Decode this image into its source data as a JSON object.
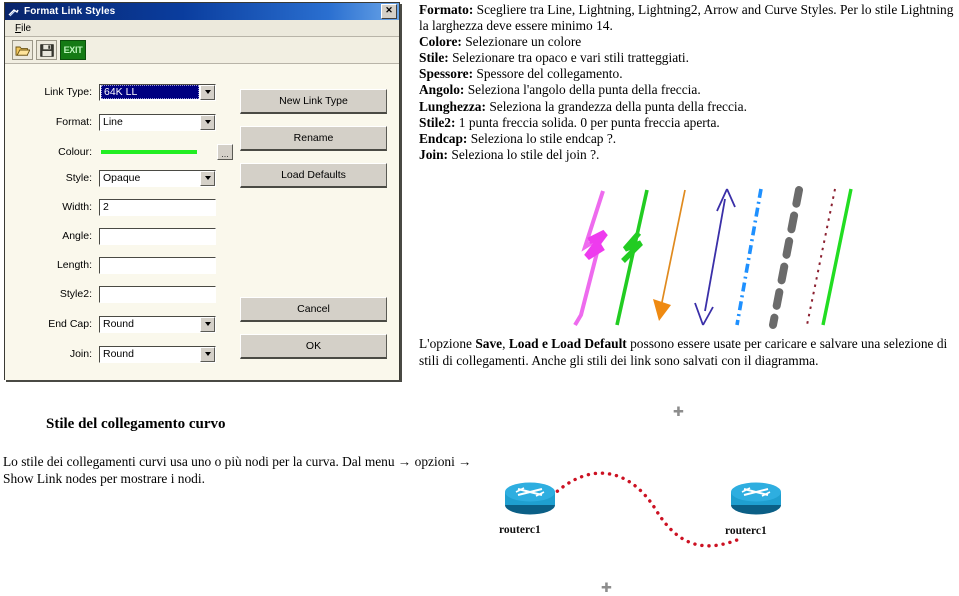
{
  "dialog": {
    "title": "Format Link Styles",
    "title_icon": "link-window-icon",
    "close_label": "✕",
    "menu": [
      {
        "label": "File",
        "accel": "F"
      }
    ],
    "toolbar": [
      {
        "name": "open-icon",
        "label": ""
      },
      {
        "name": "save-icon",
        "label": ""
      },
      {
        "name": "exit-button",
        "label": "EXIT"
      }
    ],
    "fields": [
      {
        "label": "Link Type:",
        "value": "64K LL",
        "type": "combo",
        "selected": true
      },
      {
        "label": "Format:",
        "value": "Line",
        "type": "combo",
        "selected": false
      },
      {
        "label": "Colour:",
        "value": "",
        "type": "colour",
        "swatch": "#22ee22"
      },
      {
        "label": "Style:",
        "value": "Opaque",
        "type": "combo",
        "selected": false
      },
      {
        "label": "Width:",
        "value": "2",
        "type": "text"
      },
      {
        "label": "Angle:",
        "value": "",
        "type": "text"
      },
      {
        "label": "Length:",
        "value": "",
        "type": "text"
      },
      {
        "label": "Style2:",
        "value": "",
        "type": "text"
      },
      {
        "label": "End Cap:",
        "value": "Round",
        "type": "combo",
        "selected": false
      },
      {
        "label": "Join:",
        "value": "Round",
        "type": "combo",
        "selected": false
      }
    ],
    "buttons": [
      {
        "label": "New Link Type"
      },
      {
        "label": "Rename"
      },
      {
        "label": "Load Defaults"
      },
      {
        "label": "Cancel"
      },
      {
        "label": "OK"
      }
    ]
  },
  "doc_top": {
    "lines": [
      {
        "term": "Formato:",
        "text": " Scegliere tra  Line, Lightning, Lightning2, Arrow and Curve Styles. Per lo stile Lightning la larghezza deve essere minimo 14."
      },
      {
        "term": "Colore:",
        "text": " Selezionare un colore"
      },
      {
        "term": "Stile:",
        "text": " Selezionare tra opaco e vari stili tratteggiati."
      },
      {
        "term": "Spessore:",
        "text": " Spessore del collegamento."
      },
      {
        "term": "Angolo:",
        "text": " Seleziona l'angolo della punta della freccia."
      },
      {
        "term": "Lunghezza:",
        "text": " Seleziona la grandezza della punta della freccia."
      },
      {
        "term": "Stile2:",
        "text": " 1 punta freccia solida. 0 per punta freccia aperta."
      },
      {
        "term": "Endcap:",
        "text": " Seleziona lo stile endcap ?."
      },
      {
        "term": "Join:",
        "text": " Seleziona lo stile del join ?."
      }
    ]
  },
  "samples": {
    "caption": "link style samples",
    "items": [
      {
        "name": "lightning-magenta",
        "color": "#ee55ee",
        "style": "lightning"
      },
      {
        "name": "lightning2-green",
        "color": "#22cc22",
        "style": "lightning2"
      },
      {
        "name": "arrow-orange",
        "color": "#e08a1e",
        "style": "arrow-down"
      },
      {
        "name": "arrow-double-blue",
        "color": "#3a2fa8",
        "style": "arrow-double"
      },
      {
        "name": "dashdot-blue",
        "color": "#1e90ff",
        "style": "dash-dot"
      },
      {
        "name": "dashed-gray",
        "color": "#6b6b6b",
        "style": "dashed-thick"
      },
      {
        "name": "dotted-darkred",
        "color": "#8b2030",
        "style": "dotted"
      },
      {
        "name": "solid-green",
        "color": "#22dd22",
        "style": "solid"
      }
    ]
  },
  "doc_mid": {
    "prefix": "L'opzione ",
    "b1": "Save",
    "sep1": ", ",
    "b2": "Load e Load Default",
    "text": " possono essere usate per caricare e salvare una selezione di stili di collegamenti. Anche gli stili dei link sono salvati con il diagramma."
  },
  "heading_curvo": "Stile del collegamento curvo",
  "doc_bottom": {
    "text": "Lo stile dei collegamenti curvi usa uno o più nodi per la curva. Dal menu → opzioni → Show Link nodes per mostrare i nodi."
  },
  "router_diagram": {
    "link_color": "#cc1122",
    "link_style": "dotted-curve",
    "nodes": [
      {
        "name": "router-left",
        "label": "routerc1"
      },
      {
        "name": "router-right",
        "label": "routerc1"
      }
    ]
  },
  "markers": [
    {
      "name": "node-plus-marker-top",
      "glyph": "✚"
    },
    {
      "name": "node-plus-marker-bottom",
      "glyph": "✚"
    }
  ]
}
